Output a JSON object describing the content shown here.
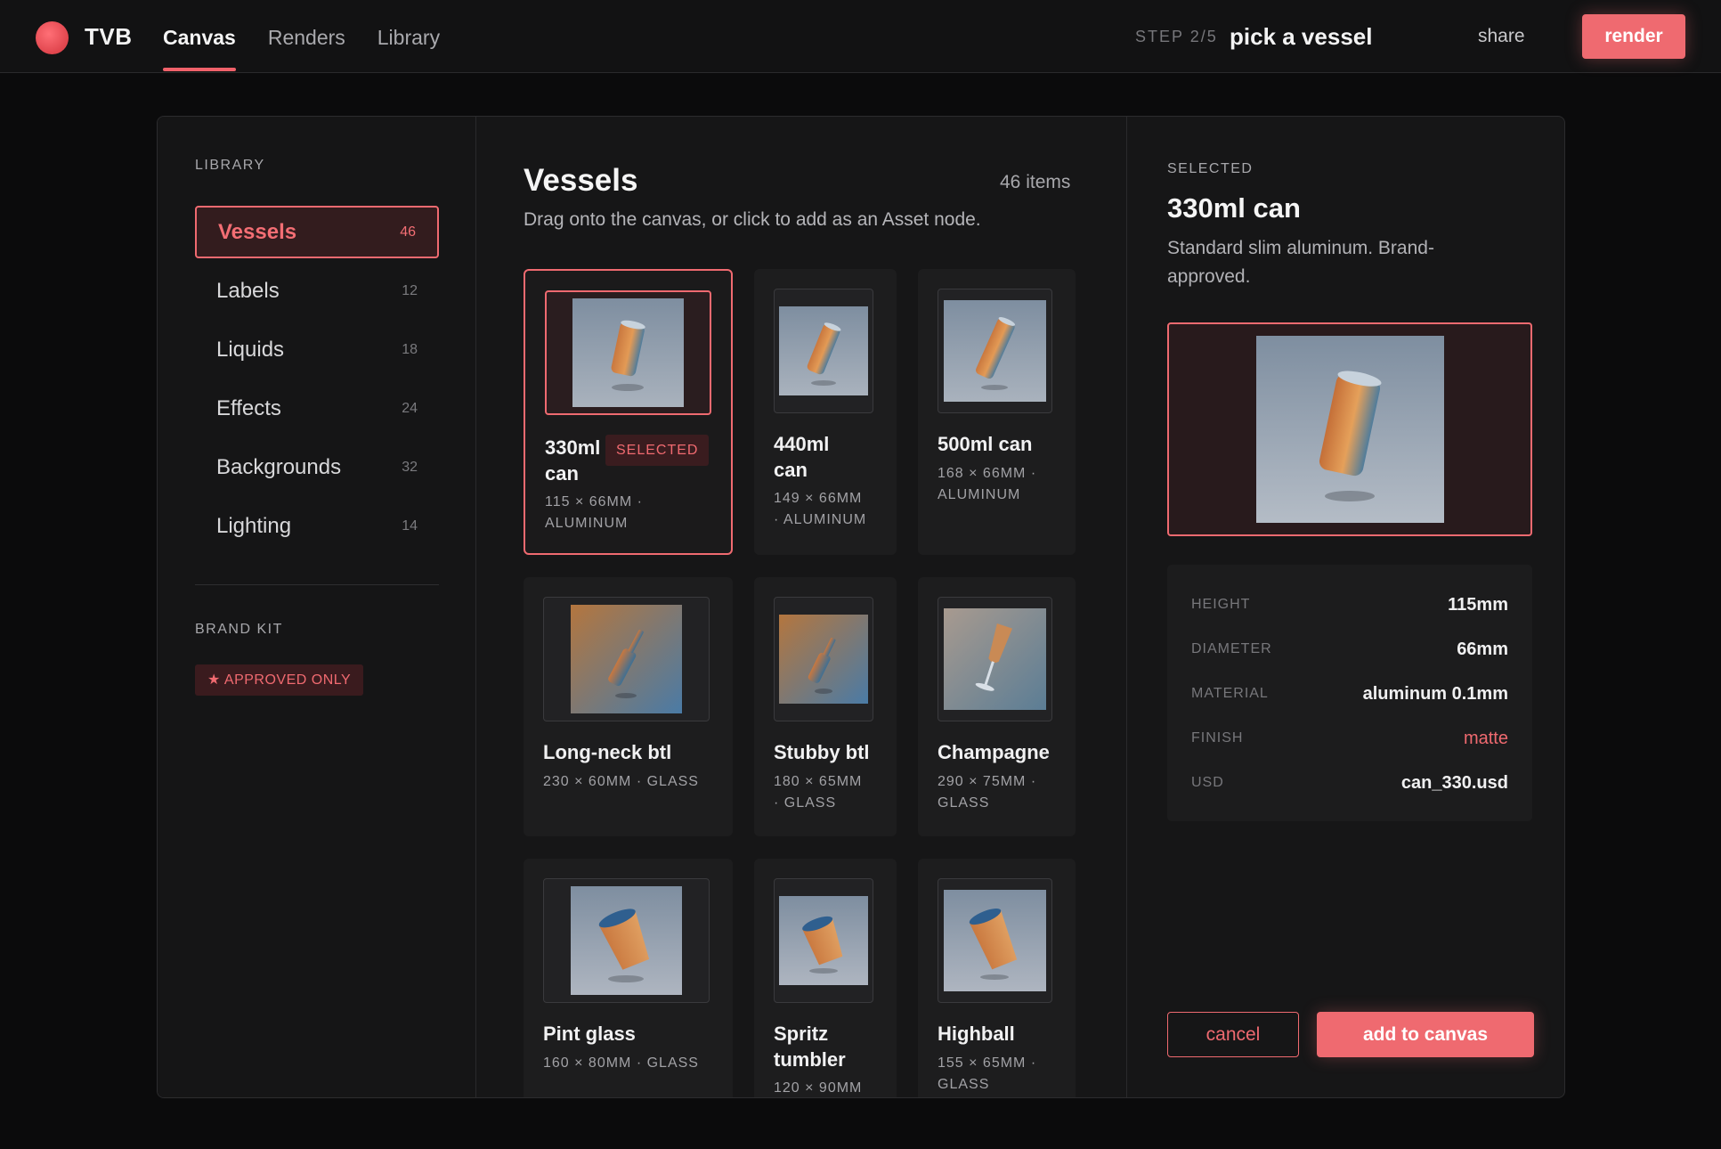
{
  "app": {
    "brand": "TVB",
    "brand_color": "#ef6a70"
  },
  "nav": {
    "items": [
      "Canvas",
      "Renders",
      "Library"
    ],
    "active": "Canvas"
  },
  "step": {
    "label": "STEP 2/5",
    "title": "pick a vessel"
  },
  "topbar": {
    "share_label": "share",
    "render_label": "render"
  },
  "sidebar": {
    "library_heading": "LIBRARY",
    "items": [
      {
        "label": "Vessels",
        "count": "46"
      },
      {
        "label": "Labels",
        "count": "12"
      },
      {
        "label": "Liquids",
        "count": "18"
      },
      {
        "label": "Effects",
        "count": "24"
      },
      {
        "label": "Backgrounds",
        "count": "32"
      },
      {
        "label": "Lighting",
        "count": "14"
      }
    ],
    "active_index": 0,
    "brand_heading": "BRAND KIT",
    "approved_badge": "★ APPROVED ONLY"
  },
  "main": {
    "title": "Vessels",
    "count": "46 items",
    "subtitle": "Drag onto the canvas, or click to add as an Asset node.",
    "selected_tag": "SELECTED",
    "cards": [
      {
        "name_lines": [
          "330ml",
          "can"
        ],
        "meta_lines": [
          "115 × 66MM ·",
          "ALUMINUM"
        ],
        "icon": "can-icon",
        "selected": true
      },
      {
        "name_lines": [
          "440ml",
          "can"
        ],
        "meta_lines": [
          "149 × 66MM",
          "· ALUMINUM"
        ],
        "icon": "can-icon"
      },
      {
        "name_lines": [
          "500ml can"
        ],
        "meta_lines": [
          "168 × 66MM ·",
          "ALUMINUM"
        ],
        "icon": "can-icon"
      },
      {
        "name_lines": [
          "Long-neck btl"
        ],
        "meta_lines": [
          "230 × 60MM · GLASS"
        ],
        "icon": "bottle-icon"
      },
      {
        "name_lines": [
          "Stubby btl"
        ],
        "meta_lines": [
          "180 × 65MM",
          "· GLASS"
        ],
        "icon": "bottle-icon"
      },
      {
        "name_lines": [
          "Champagne"
        ],
        "meta_lines": [
          "290 × 75MM ·",
          "GLASS"
        ],
        "icon": "champagne-glass-icon"
      },
      {
        "name_lines": [
          "Pint glass"
        ],
        "meta_lines": [
          "160 × 80MM · GLASS"
        ],
        "icon": "cup-icon"
      },
      {
        "name_lines": [
          "Spritz",
          "tumbler"
        ],
        "meta_lines": [
          "120 × 90MM"
        ],
        "icon": "cup-icon"
      },
      {
        "name_lines": [
          "Highball"
        ],
        "meta_lines": [
          "155 × 65MM ·",
          "GLASS"
        ],
        "icon": "cup-icon"
      }
    ]
  },
  "detail": {
    "heading": "SELECTED",
    "title": "330ml can",
    "description": "Standard slim aluminum. Brand-approved.",
    "specs": [
      {
        "key": "HEIGHT",
        "value": "115mm"
      },
      {
        "key": "DIAMETER",
        "value": "66mm"
      },
      {
        "key": "MATERIAL",
        "value": "aluminum 0.1mm"
      },
      {
        "key": "FINISH",
        "value": "matte"
      },
      {
        "key": "USD",
        "value": "can_330.usd"
      }
    ],
    "cancel_label": "cancel",
    "add_label": "add to canvas"
  }
}
